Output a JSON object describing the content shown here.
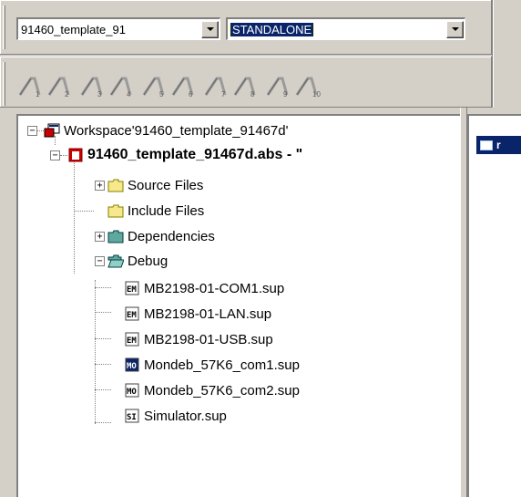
{
  "toolbar": {
    "project_combo": {
      "value": "91460_template_91"
    },
    "config_combo": {
      "value": "STANDALONE"
    },
    "bookmark_buttons": [
      {
        "num": "1"
      },
      {
        "num": "2"
      },
      {
        "num": "3"
      },
      {
        "num": "4"
      },
      {
        "num": "5"
      },
      {
        "num": "6"
      },
      {
        "num": "7"
      },
      {
        "num": "8"
      },
      {
        "num": "9"
      },
      {
        "num": "10"
      }
    ]
  },
  "workspace_tree": {
    "workspace_label": "Workspace'91460_template_91467d'",
    "project_label": "91460_template_91467d.abs - \"",
    "folders": [
      {
        "label": "Source Files",
        "icon": "folder-yellow-icon",
        "expandable": true
      },
      {
        "label": "Include Files",
        "icon": "folder-yellow-icon",
        "expandable": false
      },
      {
        "label": "Dependencies",
        "icon": "folder-teal-icon",
        "expandable": true
      },
      {
        "label": "Debug",
        "icon": "folder-open-teal-icon",
        "expandable": true
      }
    ],
    "debug_files": [
      {
        "label": "MB2198-01-COM1.sup",
        "badge": "EM",
        "active": false
      },
      {
        "label": "MB2198-01-LAN.sup",
        "badge": "EM",
        "active": false
      },
      {
        "label": "MB2198-01-USB.sup",
        "badge": "EM",
        "active": false
      },
      {
        "label": "Mondeb_57K6_com1.sup",
        "badge": "MO",
        "active": true
      },
      {
        "label": "Mondeb_57K6_com2.sup",
        "badge": "MO",
        "active": false
      },
      {
        "label": "Simulator.sup",
        "badge": "SI",
        "active": false
      }
    ]
  },
  "right_pane": {
    "window_title": "r"
  },
  "colors": {
    "selection": "#0a246a",
    "face": "#d4d0c8",
    "project_red": "#cc0000"
  }
}
